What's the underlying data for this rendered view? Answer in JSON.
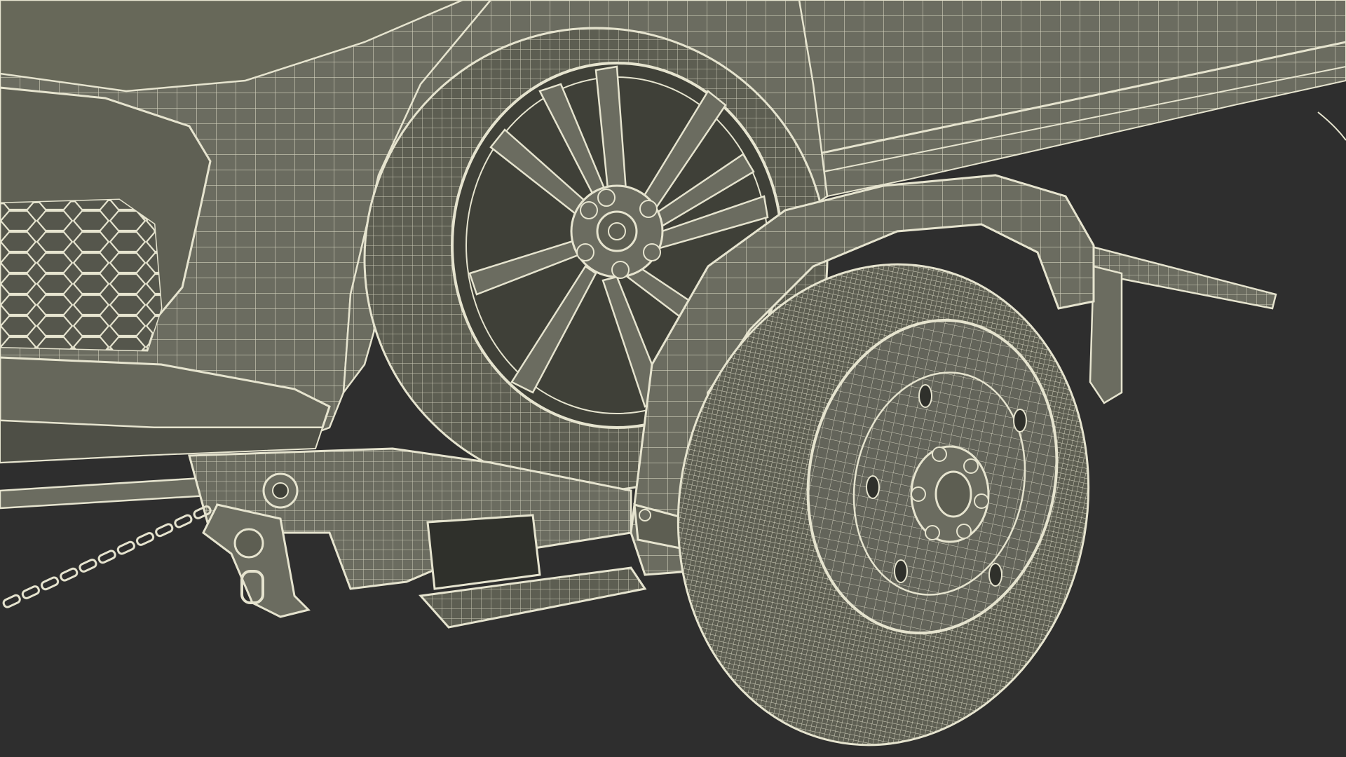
{
  "scene": {
    "background_color": "#2e2e2e",
    "body_color": "#6b6c60",
    "body_shadow_color": "#4e4f46",
    "wire_color": "#e6e4cf",
    "objects": [
      "car-front-bumper",
      "car-front-wheel",
      "car-fender",
      "wheel-lift-frame",
      "safety-chain",
      "tow-truck-fender",
      "tow-truck-wheel"
    ]
  }
}
